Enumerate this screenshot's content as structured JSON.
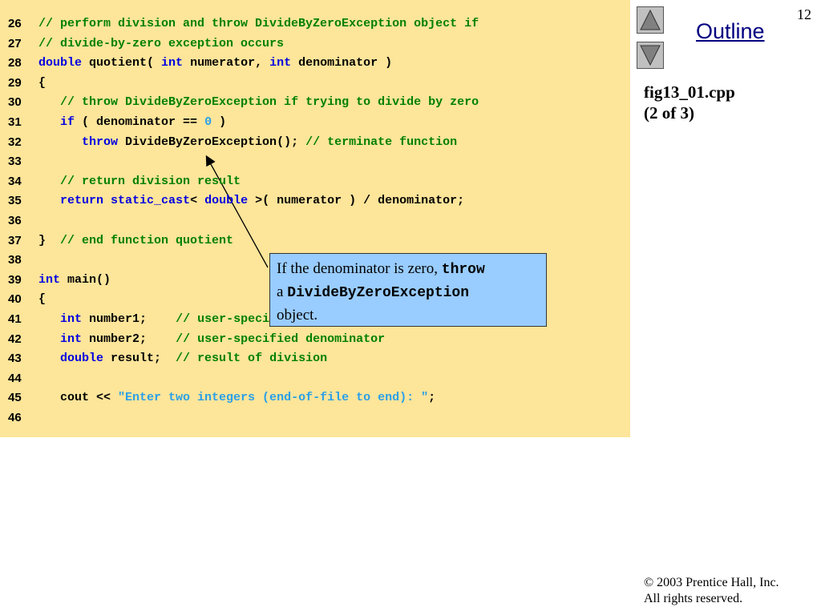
{
  "slide_number": "12",
  "outline_label": "Outline",
  "file_caption": "fig13_01.cpp",
  "part_caption": "(2 of 3)",
  "copyright_line1": "2003 Prentice Hall, Inc.",
  "copyright_line2": "All rights reserved.",
  "copyright_symbol": "©",
  "callout": {
    "t1": "If the denominator is zero, ",
    "t2": "throw",
    "t3": "a ",
    "t4": "DivideByZeroException",
    "t5": "object."
  },
  "colors": {
    "code_background": "#fde59a",
    "keyword": "#0000e0",
    "comment": "#008000",
    "string_literal": "#2aa0e8",
    "callout_background": "#99ccff",
    "outline_link": "#000080"
  },
  "code_lines": [
    {
      "num": "26",
      "segs": [
        {
          "t": "// perform division and throw DivideByZeroException object if",
          "c": "cm"
        }
      ]
    },
    {
      "num": "27",
      "segs": [
        {
          "t": "// divide-by-zero exception occurs",
          "c": "cm"
        }
      ]
    },
    {
      "num": "28",
      "segs": [
        {
          "t": "double",
          "c": "kw"
        },
        {
          "t": " quotient( ",
          "c": ""
        },
        {
          "t": "int",
          "c": "kw"
        },
        {
          "t": " numerator, ",
          "c": ""
        },
        {
          "t": "int",
          "c": "kw"
        },
        {
          "t": " denominator )",
          "c": ""
        }
      ]
    },
    {
      "num": "29",
      "segs": [
        {
          "t": "{",
          "c": ""
        }
      ]
    },
    {
      "num": "30",
      "segs": [
        {
          "t": "   ",
          "c": ""
        },
        {
          "t": "// throw DivideByZeroException if trying to divide by zero",
          "c": "cm"
        }
      ]
    },
    {
      "num": "31",
      "segs": [
        {
          "t": "   ",
          "c": ""
        },
        {
          "t": "if",
          "c": "kw"
        },
        {
          "t": " ( denominator == ",
          "c": ""
        },
        {
          "t": "0",
          "c": "nm"
        },
        {
          "t": " )",
          "c": ""
        }
      ]
    },
    {
      "num": "32",
      "segs": [
        {
          "t": "      ",
          "c": ""
        },
        {
          "t": "throw",
          "c": "kw"
        },
        {
          "t": " DivideByZeroException(); ",
          "c": ""
        },
        {
          "t": "// terminate function",
          "c": "cm"
        }
      ]
    },
    {
      "num": "33",
      "segs": []
    },
    {
      "num": "34",
      "segs": [
        {
          "t": "   ",
          "c": ""
        },
        {
          "t": "// return division result",
          "c": "cm"
        }
      ]
    },
    {
      "num": "35",
      "segs": [
        {
          "t": "   ",
          "c": ""
        },
        {
          "t": "return",
          "c": "kw"
        },
        {
          "t": " ",
          "c": ""
        },
        {
          "t": "static_cast",
          "c": "kw"
        },
        {
          "t": "< ",
          "c": ""
        },
        {
          "t": "double",
          "c": "kw"
        },
        {
          "t": " >( numerator ) / denominator;",
          "c": ""
        }
      ]
    },
    {
      "num": "36",
      "segs": []
    },
    {
      "num": "37",
      "segs": [
        {
          "t": "}  ",
          "c": ""
        },
        {
          "t": "// end function quotient",
          "c": "cm"
        }
      ]
    },
    {
      "num": "38",
      "segs": []
    },
    {
      "num": "39",
      "segs": [
        {
          "t": "int",
          "c": "kw"
        },
        {
          "t": " main()",
          "c": ""
        }
      ]
    },
    {
      "num": "40",
      "segs": [
        {
          "t": "{",
          "c": ""
        }
      ]
    },
    {
      "num": "41",
      "segs": [
        {
          "t": "   ",
          "c": ""
        },
        {
          "t": "int",
          "c": "kw"
        },
        {
          "t": " number1;    ",
          "c": ""
        },
        {
          "t": "// user-specified numerator",
          "c": "cm"
        }
      ]
    },
    {
      "num": "42",
      "segs": [
        {
          "t": "   ",
          "c": ""
        },
        {
          "t": "int",
          "c": "kw"
        },
        {
          "t": " number2;    ",
          "c": ""
        },
        {
          "t": "// user-specified denominator",
          "c": "cm"
        }
      ]
    },
    {
      "num": "43",
      "segs": [
        {
          "t": "   ",
          "c": ""
        },
        {
          "t": "double",
          "c": "kw"
        },
        {
          "t": " result;  ",
          "c": ""
        },
        {
          "t": "// result of division",
          "c": "cm"
        }
      ]
    },
    {
      "num": "44",
      "segs": []
    },
    {
      "num": "45",
      "segs": [
        {
          "t": "   cout << ",
          "c": ""
        },
        {
          "t": "\"Enter two integers (end-of-file to end): \"",
          "c": "st"
        },
        {
          "t": ";",
          "c": ""
        }
      ]
    },
    {
      "num": "46",
      "segs": []
    }
  ]
}
